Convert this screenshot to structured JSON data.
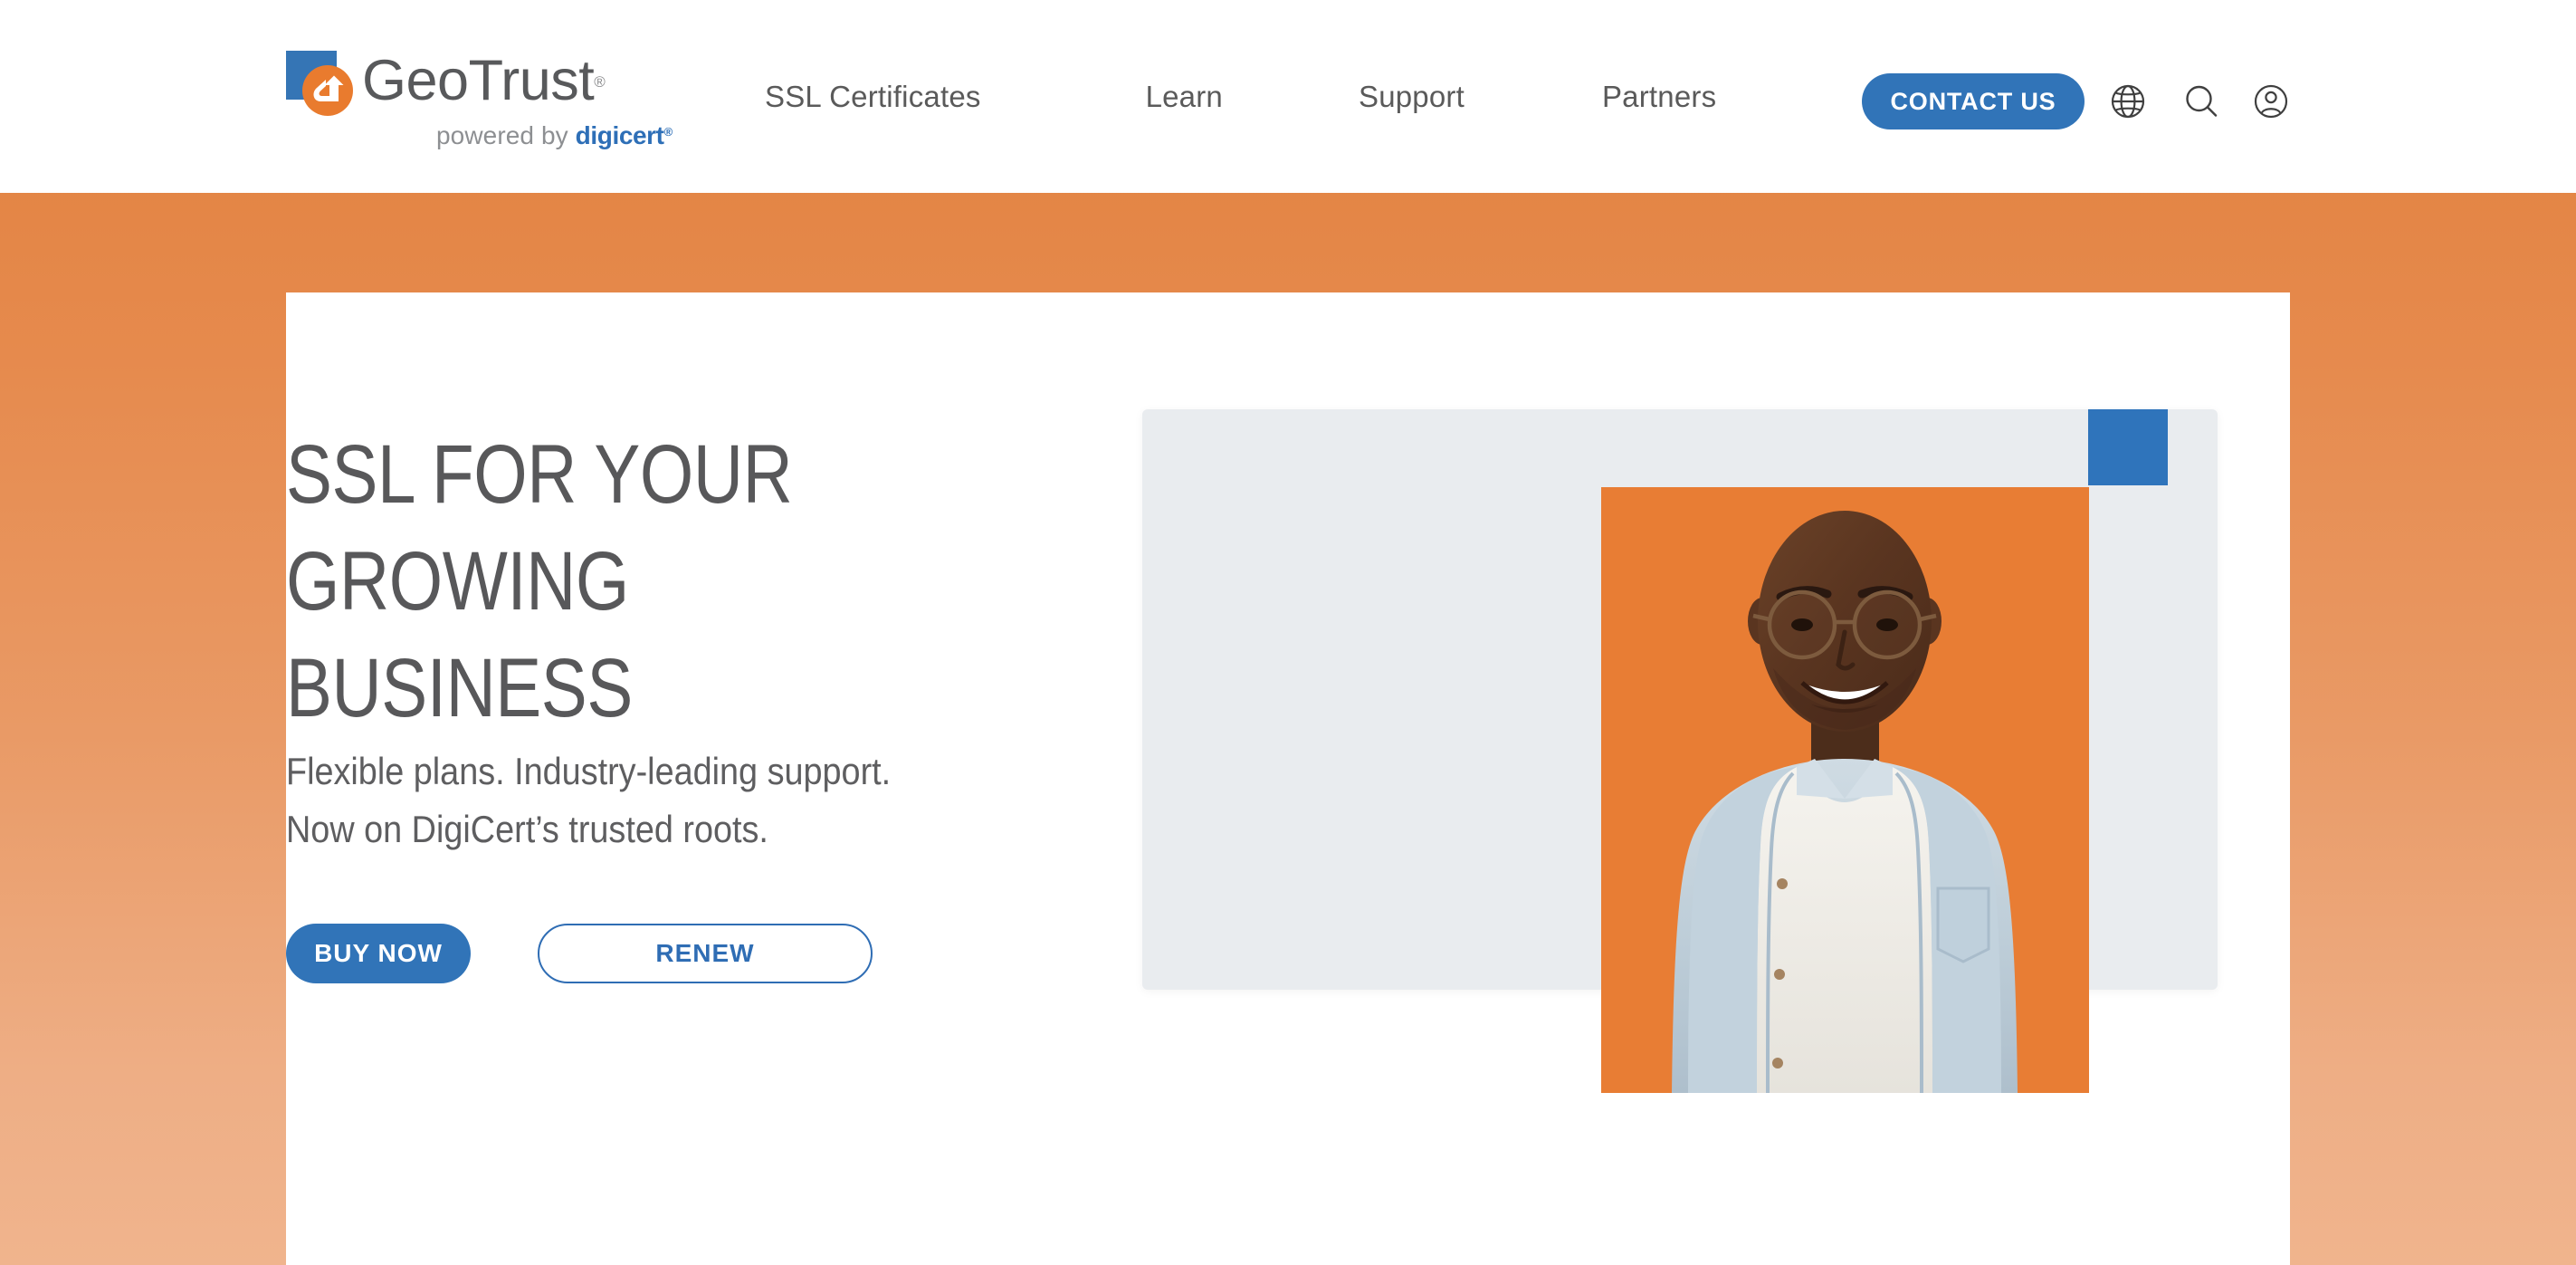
{
  "header": {
    "logo": {
      "name": "GeoTrust",
      "registered_mark": "®",
      "tagline_prefix": "powered by",
      "tagline_brand": "digicert",
      "tagline_brand_mark": "®",
      "mark_square_color": "#3575b5",
      "mark_circle_color": "#e97b2e",
      "wordmark_color": "#58595b"
    },
    "nav": [
      {
        "label": "SSL Certificates"
      },
      {
        "label": "Learn"
      },
      {
        "label": "Support"
      },
      {
        "label": "Partners"
      }
    ],
    "contact_button": {
      "label": "CONTACT US",
      "background": "#3174b8",
      "text_color": "#ffffff"
    },
    "icons": [
      {
        "name": "globe-icon",
        "title": "Language"
      },
      {
        "name": "search-icon",
        "title": "Search"
      },
      {
        "name": "account-icon",
        "title": "Account"
      }
    ]
  },
  "hero": {
    "headline": "SSL FOR YOUR GROWING\nBUSINESS",
    "subhead": "Flexible plans. Industry-leading support.\nNow on DigiCert’s trusted roots.",
    "buttons": {
      "primary": {
        "label": "BUY NOW",
        "background": "#3174b8",
        "text_color": "#ffffff"
      },
      "secondary": {
        "label": "RENEW",
        "background": "#ffffff",
        "text_color": "#2f6db4",
        "border_color": "#2f6db4"
      }
    },
    "image": {
      "alt": "Smiling man with glasses wearing a light blue denim shirt over a white t-shirt",
      "backdrop_color": "#e87d34",
      "panel_color": "#e9ecef",
      "accent_square_color": "#2f74bb"
    }
  },
  "page": {
    "background_top_color": "#e0803d",
    "background_bottom_color": "#f0b48d",
    "card_background": "#ffffff"
  }
}
